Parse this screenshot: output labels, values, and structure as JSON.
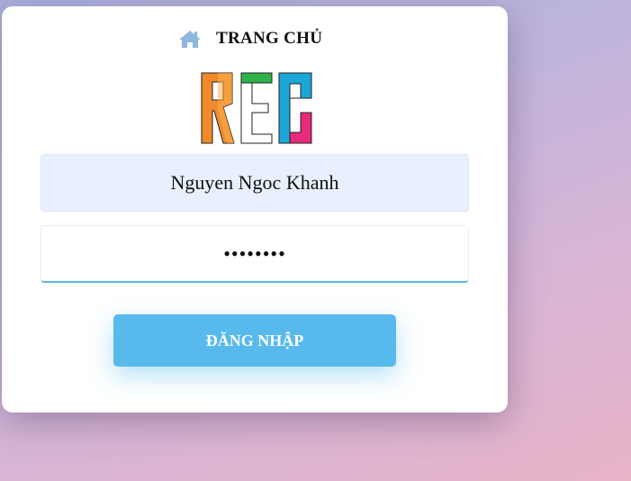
{
  "nav": {
    "home_label": "TRANG CHỦ",
    "home_icon": "home-icon"
  },
  "logo": {
    "text": "REC",
    "colors": {
      "r": "#f08a2a",
      "e_top_bar": "#2db34a",
      "c_main": "#1aa6d6",
      "c_bottom": "#e8287a"
    }
  },
  "form": {
    "username_value": "Nguyen Ngoc Khanh",
    "password_value": "••••••••",
    "submit_label": "ĐĂNG NHẬP"
  },
  "theme": {
    "accent": "#58baec",
    "input_autofill_bg": "#e8f0fe",
    "focus_underline": "#5bbad6",
    "home_icon_color": "#8fb7dd"
  }
}
